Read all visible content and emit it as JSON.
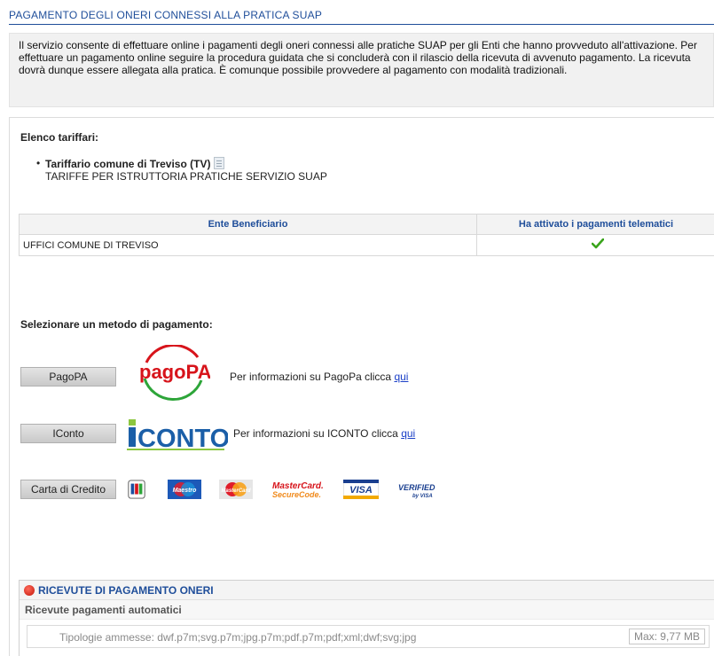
{
  "page": {
    "title": "PAGAMENTO DEGLI ONERI CONNESSI ALLA PRATICA SUAP",
    "intro": "Il servizio consente di effettuare online i pagamenti degli oneri connessi alle pratiche SUAP per gli Enti che hanno provveduto all'attivazione. Per effettuare un pagamento online seguire la procedura guidata che si concluderà con il rilascio della ricevuta di avvenuto pagamento. La ricevuta dovrà dunque essere allegata alla pratica. È comunque possibile provvedere al pagamento con modalità tradizionali."
  },
  "tariffs": {
    "heading": "Elenco tariffari:",
    "items": [
      {
        "name": "Tariffario comune di Treviso (TV)",
        "description": "TARIFFE PER ISTRUTTORIA PRATICHE SERVIZIO SUAP"
      }
    ]
  },
  "ente_table": {
    "headers": [
      "Ente Beneficiario",
      "Ha attivato i pagamenti telematici"
    ],
    "rows": [
      {
        "ente": "UFFICI COMUNE DI TREVISO",
        "activated": true
      }
    ]
  },
  "payment": {
    "heading": "Selezionare un metodo di pagamento:",
    "methods": [
      {
        "button": "PagoPA",
        "info": "Per informazioni su PagoPa clicca",
        "link": "qui",
        "logo_text": "pagoPA"
      },
      {
        "button": "IConto",
        "info": "Per informazioni su ICONTO clicca",
        "link": "qui",
        "logo_text": "iCONTO"
      },
      {
        "button": "Carta di Credito"
      }
    ],
    "cards": [
      "JCB",
      "Maestro",
      "MasterCard",
      "MasterCard SecureCode",
      "VISA",
      "VERIFIED by VISA"
    ]
  },
  "receipts": {
    "title": "RICEVUTE DI PAGAMENTO ONERI",
    "subtitle": "Ricevute pagamenti automatici",
    "allowed_types": "Tipologie ammesse: dwf.p7m;svg.p7m;jpg.p7m;pdf.p7m;pdf;xml;dwf;svg;jpg",
    "max_size": "Max: 9,77 MB"
  },
  "colors": {
    "title_blue": "#1f4e9a",
    "link_blue": "#1a3fc7",
    "check_green": "#3aa41c",
    "pagopa_red": "#d7141b",
    "pagopa_green": "#2da539",
    "iconto_blue": "#1b5fa8",
    "iconto_green": "#8cc63f"
  }
}
